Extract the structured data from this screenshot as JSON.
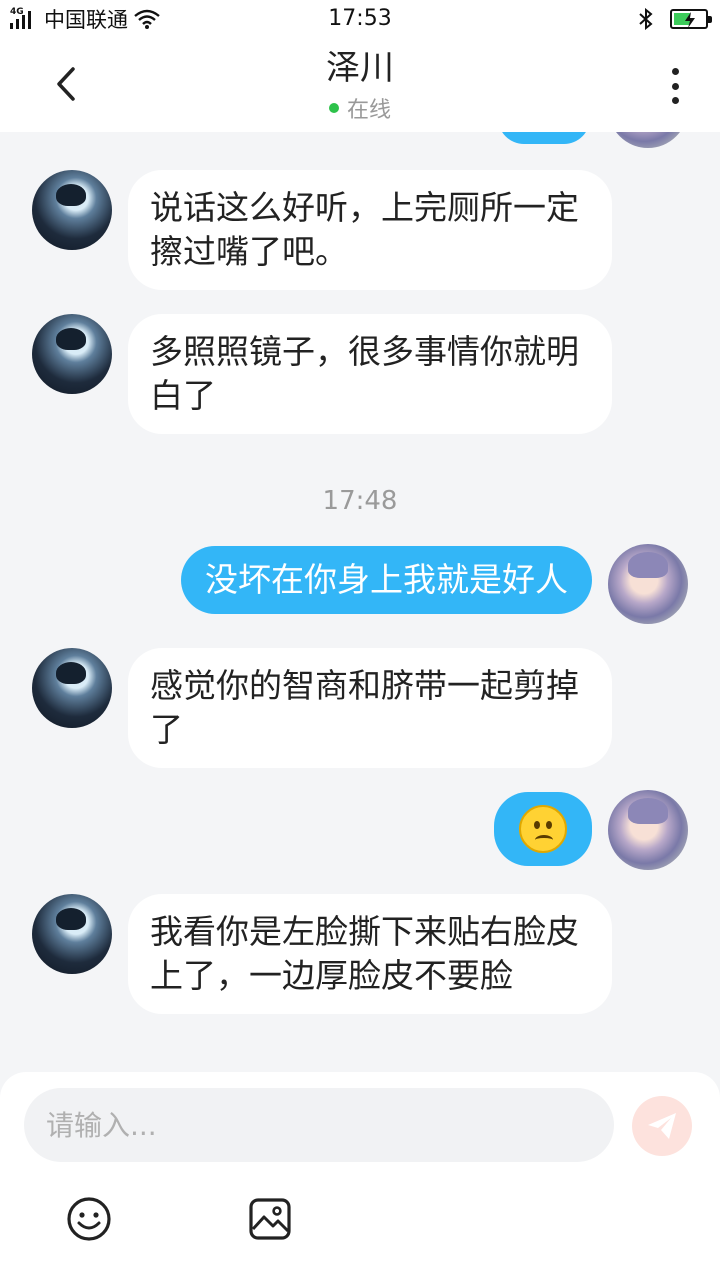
{
  "status_bar": {
    "network_type": "4G",
    "carrier": "中国联通",
    "time": "17:53",
    "icons": [
      "signal-icon",
      "wifi-icon",
      "bluetooth-icon",
      "battery-icon"
    ]
  },
  "header": {
    "title": "泽川",
    "presence": "在线",
    "presence_color": "#2dc24a",
    "icons": [
      "back-arrow-icon",
      "more-vertical-icon"
    ]
  },
  "messages": [
    {
      "side": "incoming",
      "text": "说话这么好听，上完厕所一定擦过嘴了吧。"
    },
    {
      "side": "incoming",
      "text": "多照照镜子，很多事情你就明白了"
    },
    {
      "type": "timestamp",
      "text": "17:48"
    },
    {
      "side": "outgoing",
      "text": "没坏在你身上我就是好人"
    },
    {
      "side": "incoming",
      "text": "感觉你的智商和脐带一起剪掉了"
    },
    {
      "side": "outgoing",
      "emoji": "worried-face-emoji"
    },
    {
      "side": "incoming",
      "text": "我看你是左脸撕下来贴右脸皮上了，一边厚脸皮不要脸"
    }
  ],
  "composer": {
    "placeholder": "请输入...",
    "icons": [
      "send-icon",
      "emoji-icon",
      "image-icon"
    ]
  },
  "colors": {
    "outgoing_bubble": "#33b6f7",
    "incoming_bubble": "#ffffff",
    "background": "#f4f5f7",
    "send_button": "#fde2dd"
  }
}
